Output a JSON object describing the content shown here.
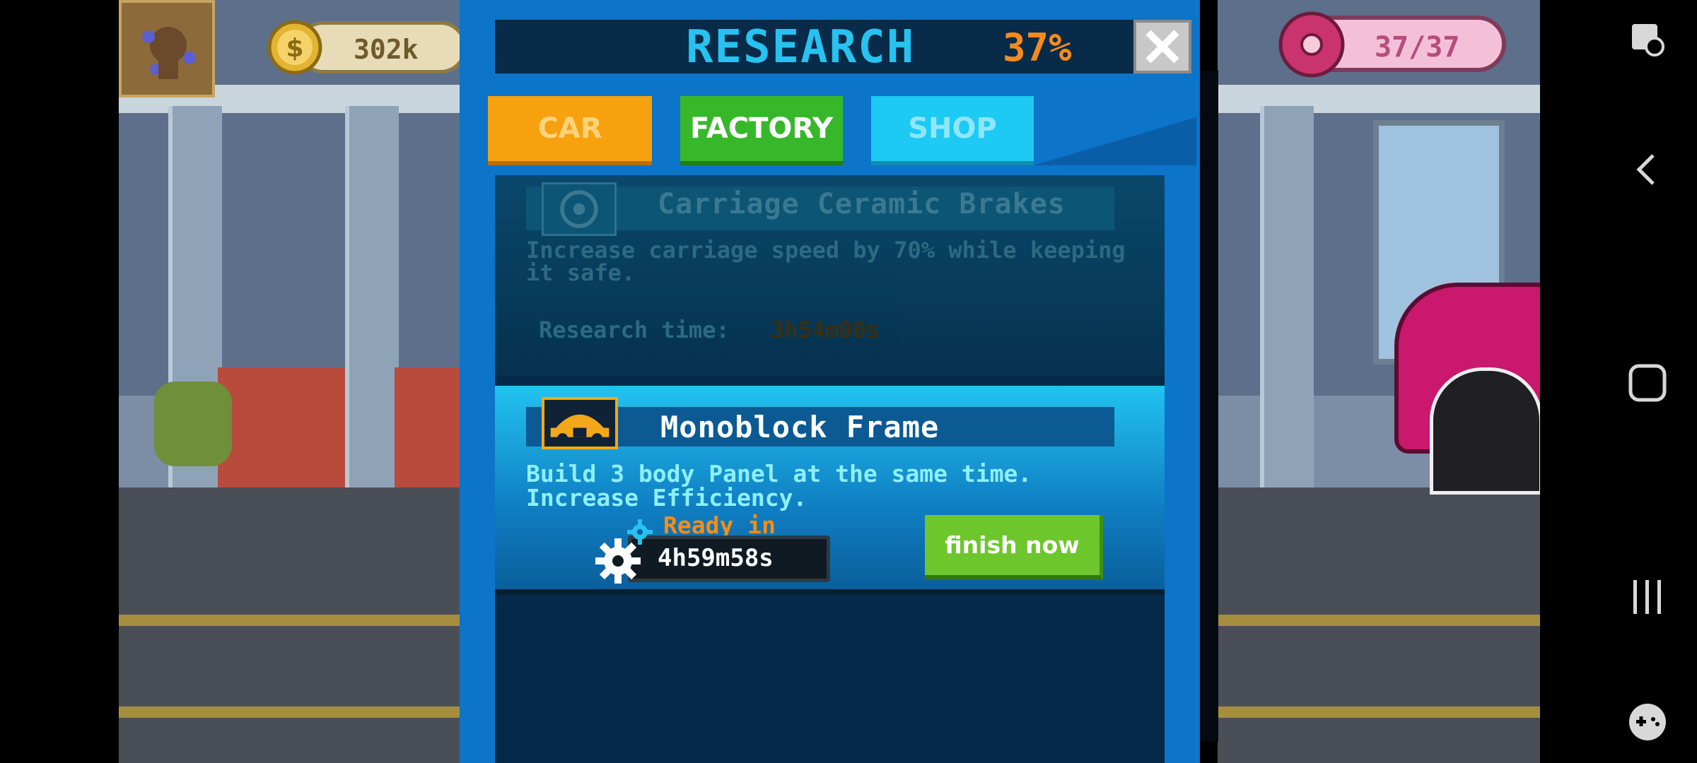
{
  "hud": {
    "coins": "302k",
    "donuts": "37/37"
  },
  "research": {
    "title": "RESEARCH",
    "percent": "37%",
    "tabs": [
      {
        "label": "CAR"
      },
      {
        "label": "FACTORY"
      },
      {
        "label": "SHOP"
      }
    ],
    "selected_tab": "FACTORY"
  },
  "locked_item": {
    "name": "Carriage Ceramic Brakes",
    "description": "Increase carriage speed by 70% while keeping it safe.",
    "research_time_label": "Research time:",
    "research_time": "3h54m00s",
    "icon": "brake-disc-icon"
  },
  "active_item": {
    "name": "Monoblock Frame",
    "description_line1": "Build 3 body Panel at the same time.",
    "description_line2": "Increase Efficiency.",
    "ready_label": "Ready in",
    "timer": "4h59m58s",
    "finish_button": "finish now",
    "icon": "car-frame-icon"
  },
  "colors": {
    "panel_blue": "#0c74c9",
    "title_cyan": "#27c2ef",
    "percent_orange": "#f78a1d",
    "finish_green": "#6cc62c"
  }
}
